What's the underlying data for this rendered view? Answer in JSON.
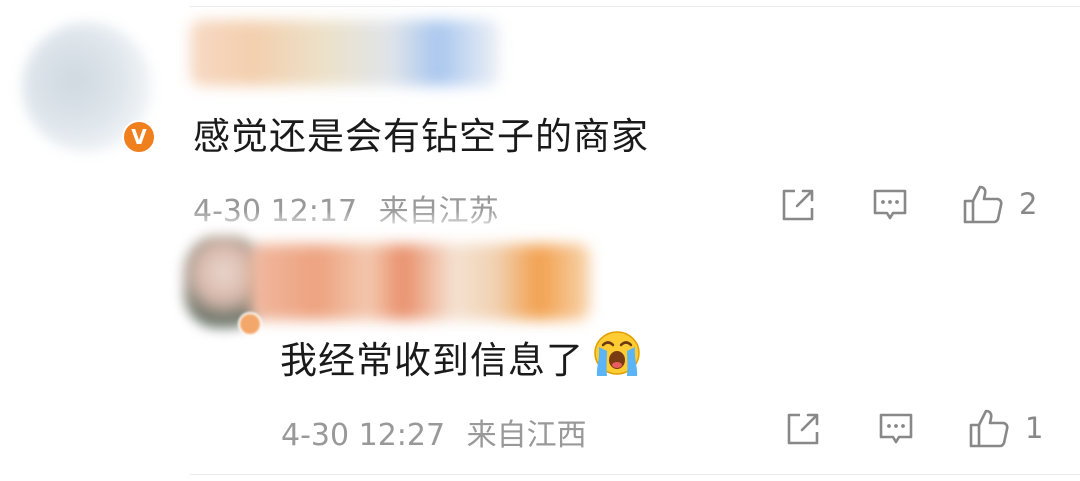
{
  "comments": [
    {
      "text": "感觉还是会有钻空子的商家",
      "date": "4-30 12:17",
      "location": "来自江苏",
      "likes": "2",
      "verified_badge": "V",
      "emoji": null,
      "icons": [
        "share-icon",
        "comment-icon",
        "like-icon"
      ]
    },
    {
      "text": "我经常收到信息了",
      "date": "4-30 12:27",
      "location": "来自江西",
      "likes": "1",
      "verified_badge": null,
      "emoji": "crying-face-emoji",
      "icons": [
        "share-icon",
        "comment-icon",
        "like-icon"
      ]
    }
  ],
  "colors": {
    "text": "#1a1a1a",
    "meta": "#999999",
    "icon": "#888888",
    "badge": "#f0801e"
  }
}
